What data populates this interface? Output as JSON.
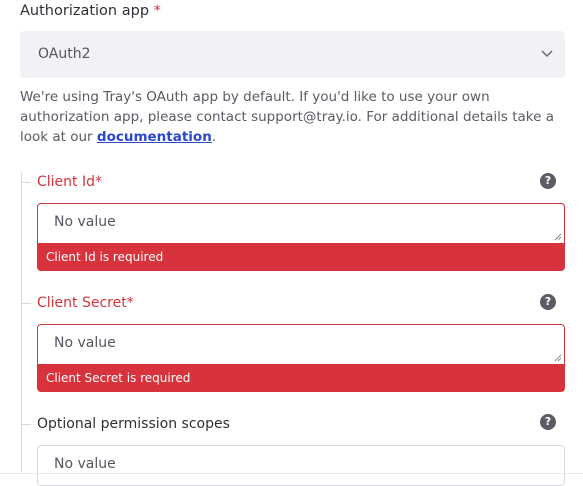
{
  "auth_app": {
    "label": "Authorization app",
    "required_marker": "*",
    "selected_value": "OAuth2",
    "description_text": "We're using Tray's OAuth app by default. If you'd like to use your own authorization app, please contact support@tray.io. For additional details take a look at our ",
    "description_link": "documentation",
    "description_end": "."
  },
  "fields": {
    "client_id": {
      "label": "Client Id*",
      "placeholder": "No value",
      "error": "Client Id is required",
      "help": "?"
    },
    "client_secret": {
      "label": "Client Secret*",
      "placeholder": "No value",
      "error": "Client Secret is required",
      "help": "?"
    },
    "scopes": {
      "label": "Optional permission scopes",
      "placeholder": "No value",
      "help": "?"
    }
  },
  "colors": {
    "error": "#d8333c",
    "link": "#2a48cc",
    "select_bg": "#f1f2f5"
  }
}
